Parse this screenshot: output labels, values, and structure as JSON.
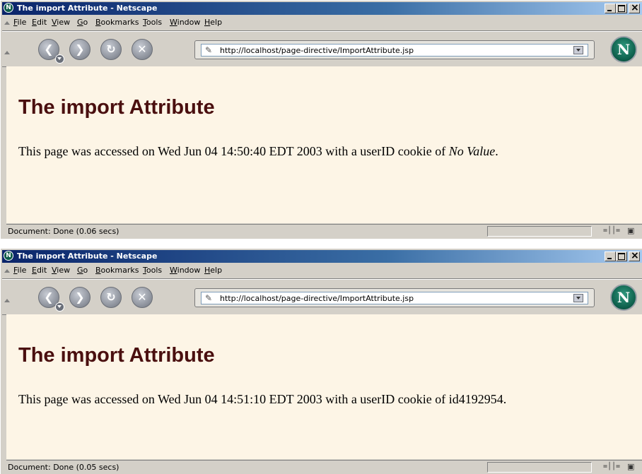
{
  "windows": [
    {
      "title": "The import Attribute - Netscape",
      "menu": [
        "File",
        "Edit",
        "View",
        "Go",
        "Bookmarks",
        "Tools",
        "Window",
        "Help"
      ],
      "url": "http://localhost/page-directive/ImportAttribute.jsp",
      "heading": "The import Attribute",
      "text_before": "This page was accessed on Wed Jun 04 14:50:40 EDT 2003 with a userID cookie of ",
      "cookie_value": "No Value",
      "text_after": ".",
      "status": "Document: Done (0.06 secs)"
    },
    {
      "title": "The import Attribute - Netscape",
      "menu": [
        "File",
        "Edit",
        "View",
        "Go",
        "Bookmarks",
        "Tools",
        "Window",
        "Help"
      ],
      "url": "http://localhost/page-directive/ImportAttribute.jsp",
      "heading": "The import Attribute",
      "text_before": "This page was accessed on Wed Jun 04 14:51:10 EDT 2003 with a userID cookie of ",
      "cookie_value": "id4192954",
      "text_after": ".",
      "status": "Document: Done (0.05 secs)"
    }
  ],
  "icons": {
    "title": "netscape-icon",
    "back": "back-arrow-icon",
    "forward": "forward-arrow-icon",
    "reload": "reload-icon",
    "stop": "stop-icon",
    "url": "page-icon",
    "logo": "netscape-logo",
    "connection": "connection-icon",
    "security": "lock-icon"
  },
  "colors": {
    "title_bar": "#0a246a",
    "page_background": "#fdf5e6",
    "heading": "#4a0f0f",
    "chrome": "#d4d0c8"
  }
}
